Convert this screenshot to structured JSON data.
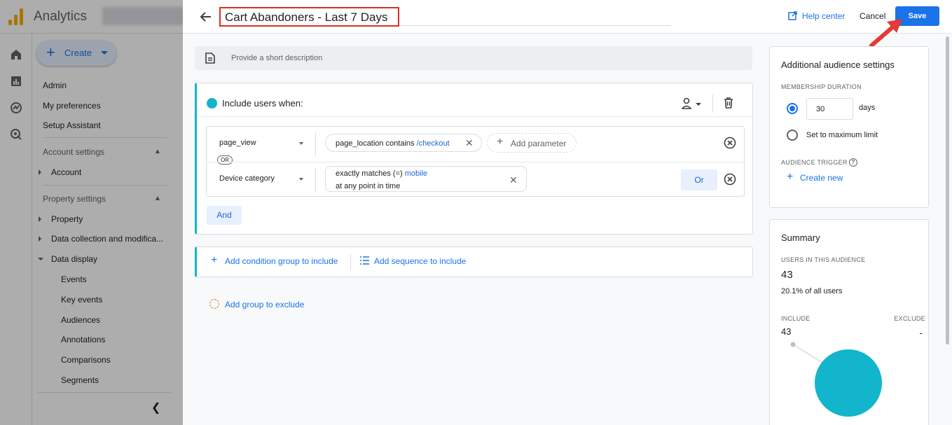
{
  "app": {
    "name": "Analytics"
  },
  "sidebar": {
    "create_label": "Create",
    "items_top": [
      "Admin",
      "My preferences",
      "Setup Assistant"
    ],
    "account_settings": {
      "label": "Account settings",
      "items": [
        "Account"
      ]
    },
    "property_settings": {
      "label": "Property settings",
      "items": [
        "Property",
        "Data collection and modifica...",
        "Data display"
      ]
    },
    "data_display_items": [
      "Events",
      "Key events",
      "Audiences",
      "Annotations",
      "Comparisons",
      "Segments"
    ]
  },
  "header": {
    "title": "Cart Abandoners - Last 7 Days",
    "help_label": "Help center",
    "cancel_label": "Cancel",
    "save_label": "Save"
  },
  "description": {
    "placeholder": "Provide a short description"
  },
  "include_group": {
    "title": "Include users when:",
    "conditions": [
      {
        "dimension": "page_view",
        "filter_prefix": "page_location contains ",
        "filter_value": "/checkout",
        "add_parameter_label": "Add parameter"
      },
      {
        "dimension": "Device category",
        "filter_prefix": "exactly matches (=) ",
        "filter_value": "mobile",
        "filter_scope": "at any point in time"
      }
    ],
    "or_pill_label": "OR",
    "or_button_label": "Or",
    "and_button_label": "And"
  },
  "add_group": {
    "condition_label": "Add condition group to include",
    "sequence_label": "Add sequence to include",
    "exclude_label": "Add group to exclude"
  },
  "settings_card": {
    "title": "Additional audience settings",
    "membership_label": "MEMBERSHIP DURATION",
    "duration_value": "30",
    "duration_unit": "days",
    "max_limit_label": "Set to maximum limit",
    "trigger_label": "AUDIENCE TRIGGER",
    "create_new_label": "Create new"
  },
  "summary_card": {
    "title": "Summary",
    "users_label": "USERS IN THIS AUDIENCE",
    "users_count": "43",
    "users_percent": "20.1% of all users",
    "include_label": "INCLUDE",
    "include_value": "43",
    "exclude_label": "EXCLUDE",
    "exclude_value": "-"
  },
  "colors": {
    "accent": "#1a73e8",
    "include_teal": "#12b5cb",
    "highlight_red": "#d93025",
    "exclude_orange": "#e8710a"
  }
}
